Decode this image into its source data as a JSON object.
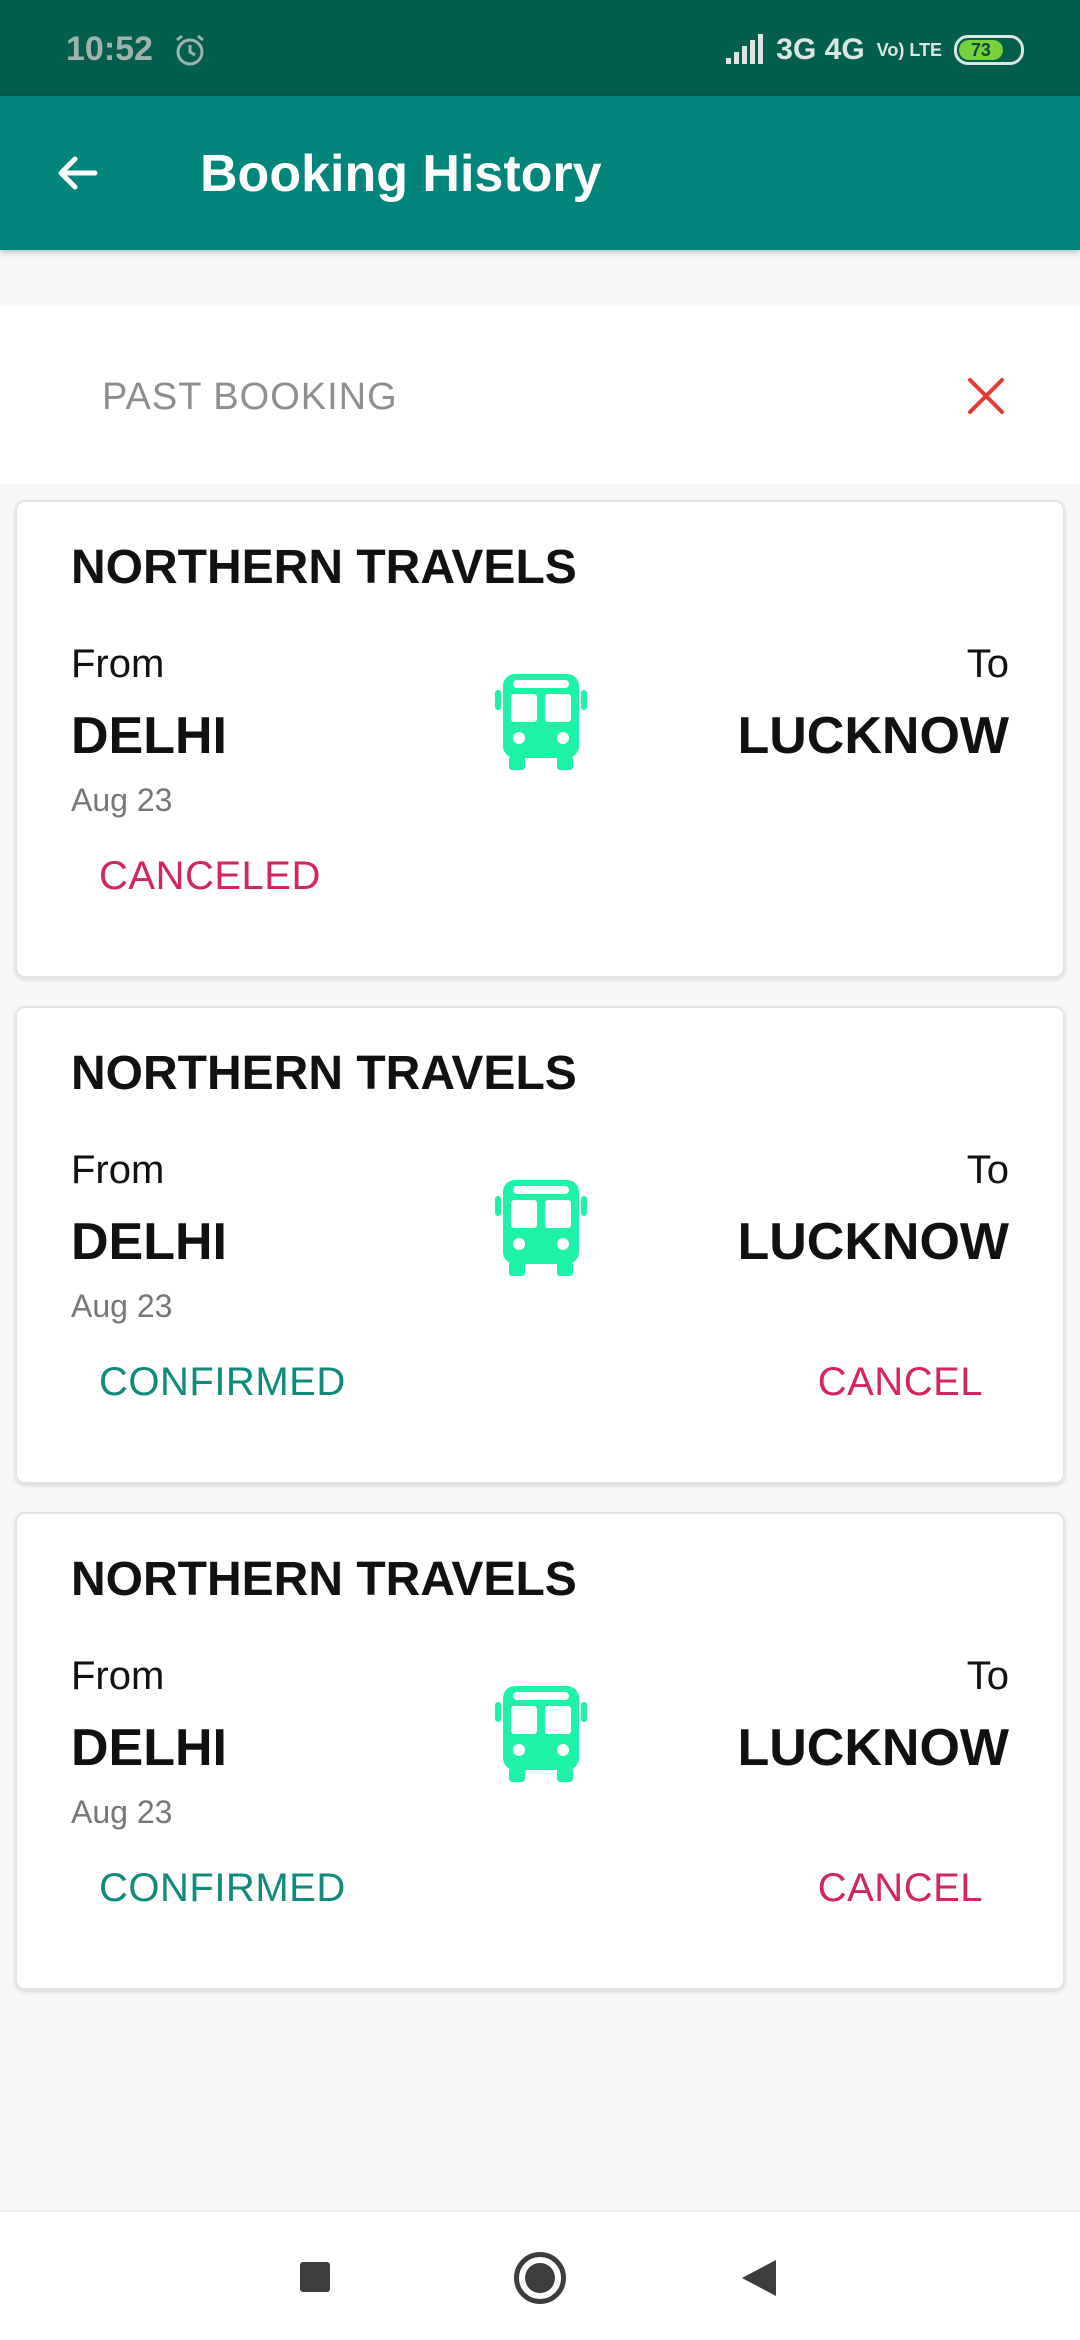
{
  "status_bar": {
    "time": "10:52",
    "network": "3G 4G",
    "lte": "Vo) LTE",
    "battery": "73",
    "battery_level": 0.73
  },
  "app_bar": {
    "title": "Booking History"
  },
  "section": {
    "title": "PAST BOOKING"
  },
  "bookings": [
    {
      "company": "NORTHERN TRAVELS",
      "from_label": "From",
      "to_label": "To",
      "from_city": "DELHI",
      "to_city": "LUCKNOW",
      "date": "Aug 23",
      "status": "CANCELED",
      "cancel_label": ""
    },
    {
      "company": "NORTHERN TRAVELS",
      "from_label": "From",
      "to_label": "To",
      "from_city": "DELHI",
      "to_city": "LUCKNOW",
      "date": "Aug 23",
      "status": "CONFIRMED",
      "cancel_label": "CANCEL"
    },
    {
      "company": "NORTHERN TRAVELS",
      "from_label": "From",
      "to_label": "To",
      "from_city": "DELHI",
      "to_city": "LUCKNOW",
      "date": "Aug 23",
      "status": "CONFIRMED",
      "cancel_label": "CANCEL"
    }
  ],
  "colors": {
    "status_bar": "#045e4e",
    "app_bar": "#01857a",
    "bus_icon": "#1ef2a6",
    "canceled": "#d2265d",
    "confirmed": "#0f8a7b",
    "close_icon": "#e53935"
  }
}
